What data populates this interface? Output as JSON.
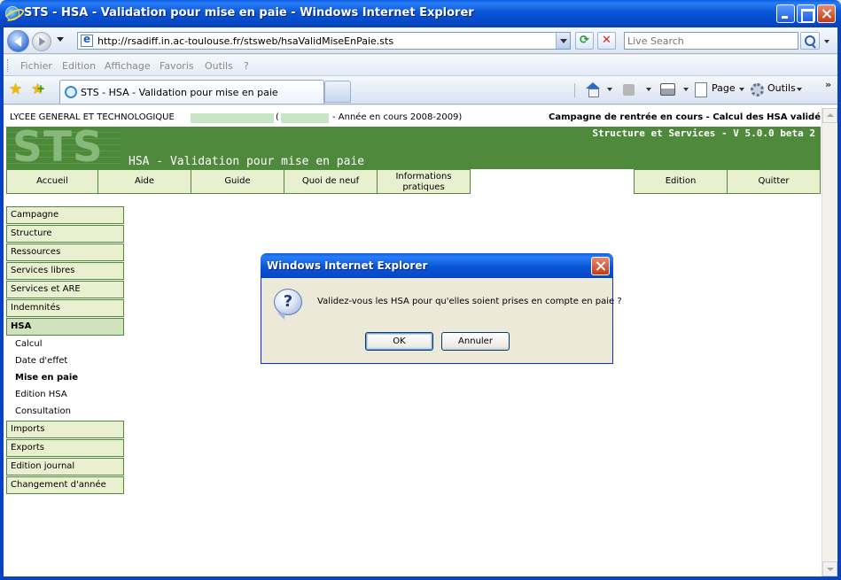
{
  "window": {
    "title": "STS - HSA - Validation pour mise en paie - Windows Internet Explorer"
  },
  "address_bar": {
    "url": "http://rsadiff.in.ac-toulouse.fr/stsweb/hsaValidMiseEnPaie.sts",
    "search_placeholder": "Live Search"
  },
  "menu": [
    "Fichier",
    "Edition",
    "Affichage",
    "Favoris",
    "Outils",
    "?"
  ],
  "tab": {
    "label": "STS - HSA - Validation pour mise en paie"
  },
  "commands": {
    "page": "Page",
    "tools": "Outils",
    "more": "»"
  },
  "page": {
    "establishment": "LYCEE GENERAL ET TECHNOLOGIQUE",
    "paren_open": "(",
    "year": "- Année en cours 2008-2009)",
    "campaign": "Campagne de rentrée en cours - Calcul des HSA validé",
    "logo": "STS",
    "version": "Structure et Services - V 5.0.0 beta 2",
    "heading": "HSA - Validation pour mise en paie",
    "topnav": [
      "Accueil",
      "Aide",
      "Guide",
      "Quoi de neuf",
      "Informations",
      "pratiques",
      "Edition",
      "Quitter"
    ],
    "sidenav_top": [
      "Campagne",
      "Structure",
      "Ressources",
      "Services libres",
      "Services et ARE",
      "Indemnités",
      "HSA"
    ],
    "hsa_sublinks": [
      "Calcul",
      "Date d'effet",
      "Mise en paie",
      "Edition HSA",
      "Consultation"
    ],
    "sidenav_bottom": [
      "Imports",
      "Exports",
      "Edition journal",
      "Changement d'année"
    ]
  },
  "dialog": {
    "title": "Windows Internet Explorer",
    "message": "Validez-vous les HSA pour qu'elles soient prises en compte en paie ?",
    "ok_label": "OK",
    "cancel_label": "Annuler",
    "icon": "question-icon"
  }
}
